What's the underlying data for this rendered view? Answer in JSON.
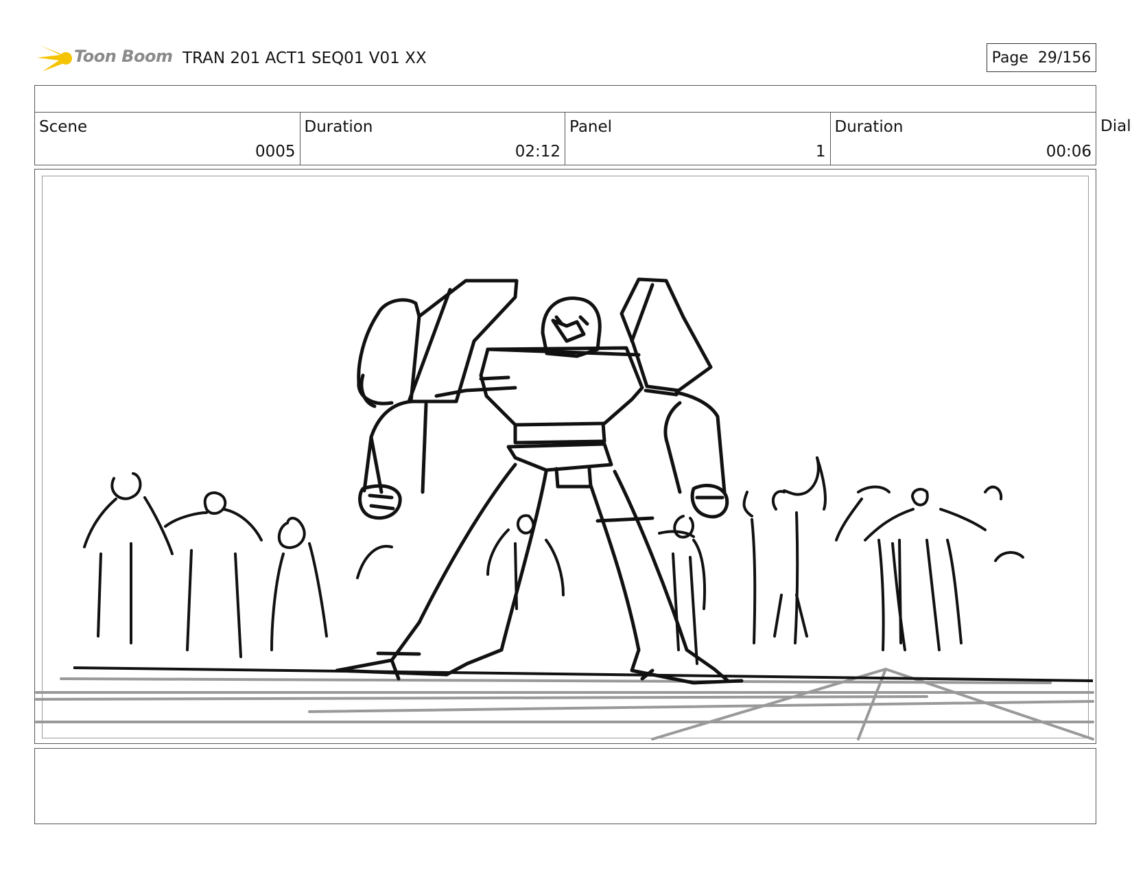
{
  "header": {
    "logo_text": "Toon Boom",
    "title": "TRAN 201 ACT1 SEQ01 V01 XX",
    "page": "Page  29/156"
  },
  "info": {
    "scene_label": "Scene",
    "scene_value": "0005",
    "duration_label": "Duration",
    "duration_value": "02:12",
    "panel_label": "Panel",
    "panel_value": "1",
    "panel_duration_label": "Duration",
    "panel_duration_value": "00:06",
    "dialog_label": "Dialog"
  },
  "panel": {
    "image": "storyboard-sketch-robot-crowd"
  },
  "colors": {
    "logo_accent": "#f5c400",
    "logo_text": "#8a8a8a",
    "border": "#555555",
    "sketch_line": "#111111",
    "perspective_grid": "#999999"
  }
}
